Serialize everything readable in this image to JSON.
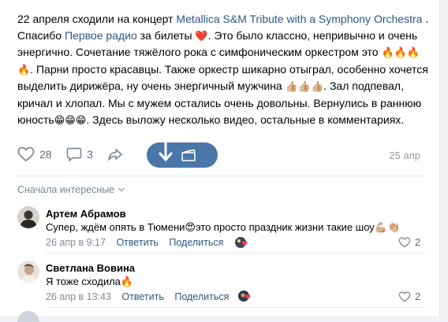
{
  "post": {
    "text_1": "22 апреля сходили на концерт ",
    "link_1": "Metallica S&M Tribute with a Symphony Orchestra",
    "text_2": " . Спасибо ",
    "link_2": "Первое радио",
    "text_3": " за билеты ",
    "heart": "❤️",
    "text_4": ". Это было классно, непривычно и очень энергично. Сочетание тяжёлого рока с симфоническим оркестром это ",
    "fire4": "🔥🔥🔥🔥",
    "text_5": ". Парни просто красавцы. Также оркестр шикарно отыграл, особенно хочется выделить дирижёра, ну очень энергичный мужчина ",
    "thumbs": "👍🏼👍🏼👍🏼",
    "text_6": ". Зал подпевал, кричал и хлопал. Мы с мужем остались очень довольны. Вернулись в раннюю юность",
    "grins": "😁😁😁",
    "text_7": ". Здесь выложу несколько видео, остальные в комментариях."
  },
  "actions": {
    "likes": "28",
    "comments": "3",
    "date": "25 апр"
  },
  "filter": {
    "label": "Сначала интересные"
  },
  "comments": [
    {
      "name": "Артем Абрамов",
      "text_a": "Супер, ждём опять в Тюмени",
      "emoji_a": "😍",
      "text_b": "это просто праздник жизни такие шоу",
      "emoji_b": "💪🏼👏🏼",
      "date": "26 апр в 9:17",
      "reply": "Ответить",
      "edit": "Поделиться",
      "likes": "2"
    },
    {
      "name": "Светлана Вовина",
      "text_a": "Я тоже сходила",
      "emoji_a": "🔥",
      "date": "26 апр в 13:43",
      "reply": "Ответить",
      "edit": "Поделиться",
      "likes": "2"
    }
  ],
  "colors": {
    "link": "#2a5885",
    "accent": "#4a76a8",
    "muted": "#818c99"
  },
  "icons": [
    "heart-icon",
    "comment-icon",
    "share-icon",
    "download-arrow-icon",
    "clapperboard-icon",
    "chevron-down-icon",
    "reaction-icon"
  ]
}
